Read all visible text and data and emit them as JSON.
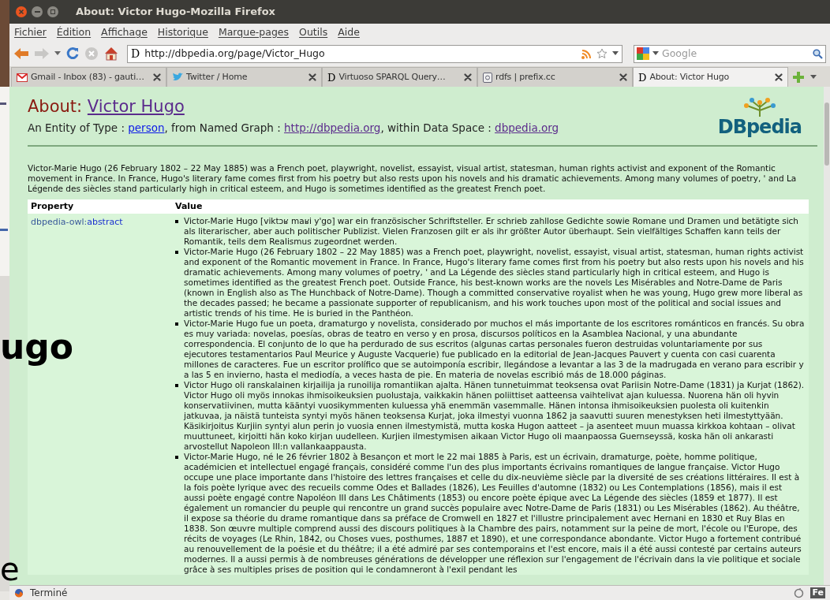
{
  "window": {
    "title": "About: Victor Hugo-Mozilla Firefox"
  },
  "menu": [
    "Fichier",
    "Édition",
    "Affichage",
    "Historique",
    "Marque-pages",
    "Outils",
    "Aide"
  ],
  "address_bar": {
    "site_icon": "D",
    "value": "http://dbpedia.org/page/Victor_Hugo"
  },
  "search": {
    "placeholder": "Google"
  },
  "tabs": [
    {
      "kind": "mail",
      "label": "Gmail - Inbox (83) - gauti…",
      "selected": false
    },
    {
      "kind": "bird",
      "label": "Twitter / Home",
      "selected": false
    },
    {
      "kind": "letter",
      "favicon": "D",
      "label": "Virtuoso SPARQL Query…",
      "selected": false
    },
    {
      "kind": "page",
      "label": "rdfs | prefix.cc",
      "selected": false
    },
    {
      "kind": "letter",
      "favicon": "D",
      "label": "About: Victor Hugo",
      "selected": true
    }
  ],
  "page": {
    "heading_label": "About:",
    "heading_link": "Victor Hugo",
    "entity_line": [
      {
        "kind": "text",
        "text": "An Entity of Type : "
      },
      {
        "kind": "link",
        "text": "person",
        "visited": false
      },
      {
        "kind": "text",
        "text": ", from Named Graph : "
      },
      {
        "kind": "link",
        "text": "http://dbpedia.org",
        "visited": true
      },
      {
        "kind": "text",
        "text": ", within Data Space : "
      },
      {
        "kind": "link",
        "text": "dbpedia.org",
        "visited": true
      }
    ],
    "logo": "DBpedia",
    "intro": "Victor-Marie Hugo (26 February 1802 – 22 May 1885) was a French poet, playwright, novelist, essayist, visual artist, statesman, human rights activist and exponent of the Romantic movement in France. In France, Hugo's literary fame comes first from his poetry but also rests upon his novels and his dramatic achievements. Among many volumes of poetry, ' and La Légende des siècles stand particularly high in critical esteem, and Hugo is sometimes identified as the greatest French poet.",
    "table": {
      "columns": [
        "Property",
        "Value"
      ],
      "rows": [
        {
          "property_prefix": "dbpedia-owl:",
          "property_name": "abstract",
          "values": [
            "Victor-Marie Hugo [viktɔʁ maʁi y'go] war ein französischer Schriftsteller. Er schrieb zahllose Gedichte sowie Romane und Dramen und betätigte sich als literarischer, aber auch politischer Publizist. Vielen Franzosen gilt er als ihr größter Autor überhaupt. Sein vielfältiges Schaffen kann teils der Romantik, teils dem Realismus zugeordnet werden.",
            "Victor-Marie Hugo (26 February 1802 – 22 May 1885) was a French poet, playwright, novelist, essayist, visual artist, statesman, human rights activist and exponent of the Romantic movement in France. In France, Hugo's literary fame comes first from his poetry but also rests upon his novels and his dramatic achievements. Among many volumes of poetry, ' and La Légende des siècles stand particularly high in critical esteem, and Hugo is sometimes identified as the greatest French poet. Outside France, his best-known works are the novels Les Misérables and Notre-Dame de Paris (known in English also as The Hunchback of Notre-Dame). Though a committed conservative royalist when he was young, Hugo grew more liberal as the decades passed; he became a passionate supporter of republicanism, and his work touches upon most of the political and social issues and artistic trends of his time. He is buried in the Panthéon.",
            "Victor-Marie Hugo fue un poeta, dramaturgo y novelista, considerado por muchos el más importante de los escritores románticos en francés. Su obra es muy variada: novelas, poesías, obras de teatro en verso y en prosa, discursos políticos en la Asamblea Nacional, y una abundante correspondencia. El conjunto de lo que ha perdurado de sus escritos (algunas cartas personales fueron destruidas voluntariamente por sus ejecutores testamentarios Paul Meurice y Auguste Vacquerie) fue publicado en la editorial de Jean-Jacques Pauvert y cuenta con casi cuarenta millones de caracteres. Fue un escritor prolífico que se autoimponía escribir, llegándose a levantar a las 3 de la madrugada en verano para escribir y a las 5 en invierno, hasta el mediodía, a veces hasta de pie. En materia de novelas escribió más de 18.000 páginas.",
            "Victor Hugo oli ranskalainen kirjailija ja runoilija romantiikan ajalta. Hänen tunnetuimmat teoksensa ovat Pariisin Notre-Dame (1831) ja Kurjat (1862). Victor Hugo oli myös innokas ihmisoikeuksien puolustaja, vaikkakin hänen poliittiset aatteensa vaihtelivat ajan kuluessa. Nuorena hän oli hyvin konservatiivinen, mutta kääntyi vuosikymmenten kuluessa yhä enemmän vasemmalle. Hänen intonsa ihmisoikeuksien puolesta oli kuitenkin jatkuvaa, ja näistä tunteista syntyi myös hänen teoksensa Kurjat, joka ilmestyi vuonna 1862 ja saavutti suuren menestyksen heti ilmestyttyään. Käsikirjoitus Kurjiin syntyi alun perin jo vuosia ennen ilmestymistä, mutta koska Hugon aatteet – ja asenteet muun muassa kirkkoa kohtaan – olivat muuttuneet, kirjoitti hän koko kirjan uudelleen. Kurjien ilmestymisen aikaan Victor Hugo oli maanpaossa Guernseyssä, koska hän oli ankarasti arvostellut Napoleon III:n vallankaappausta.",
            "Victor-Marie Hugo, né le 26 février 1802 à Besançon et mort le 22 mai 1885 à Paris, est un écrivain, dramaturge, poète, homme politique, académicien et intellectuel engagé français, considéré comme l'un des plus importants écrivains romantiques de langue française. Victor Hugo occupe une place importante dans l'histoire des lettres françaises et celle du dix-neuvième siècle par la diversité de ses créations littéraires. Il est à la fois poète lyrique avec des recueils comme Odes et Ballades (1826), Les Feuilles d'automne (1832) ou Les Contemplations (1856), mais il est aussi poète engagé contre Napoléon III dans Les Châtiments (1853) ou encore poète épique avec La Légende des siècles (1859 et 1877). Il est également un romancier du peuple qui rencontre un grand succès populaire avec Notre-Dame de Paris (1831) ou Les Misérables (1862). Au théâtre, il expose sa théorie du drame romantique dans sa préface de Cromwell en 1827 et l'illustre principalement avec Hernani en 1830 et Ruy Blas en 1838. Son œuvre multiple comprend aussi des discours politiques à la Chambre des pairs, notamment sur la peine de mort, l'école ou l'Europe, des récits de voyages (Le Rhin, 1842, ou Choses vues, posthumes, 1887 et 1890), et une correspondance abondante. Victor Hugo a fortement contribué au renouvellement de la poésie et du théâtre; il a été admiré par ses contemporains et l'est encore, mais il a été aussi contesté par certains auteurs modernes. Il a aussi permis à de nombreuses générations de développer une réflexion sur l'engagement de l'écrivain dans la vie politique et sociale grâce à ses multiples prises de position qui le condamneront à l'exil pendant les"
          ]
        }
      ]
    }
  },
  "status_bar": {
    "text": "Terminé",
    "badge": "Fe"
  },
  "overlay_fragments": [
    {
      "kind": "large",
      "text": "ugo"
    },
    {
      "kind": "bottom",
      "text": "e"
    }
  ]
}
